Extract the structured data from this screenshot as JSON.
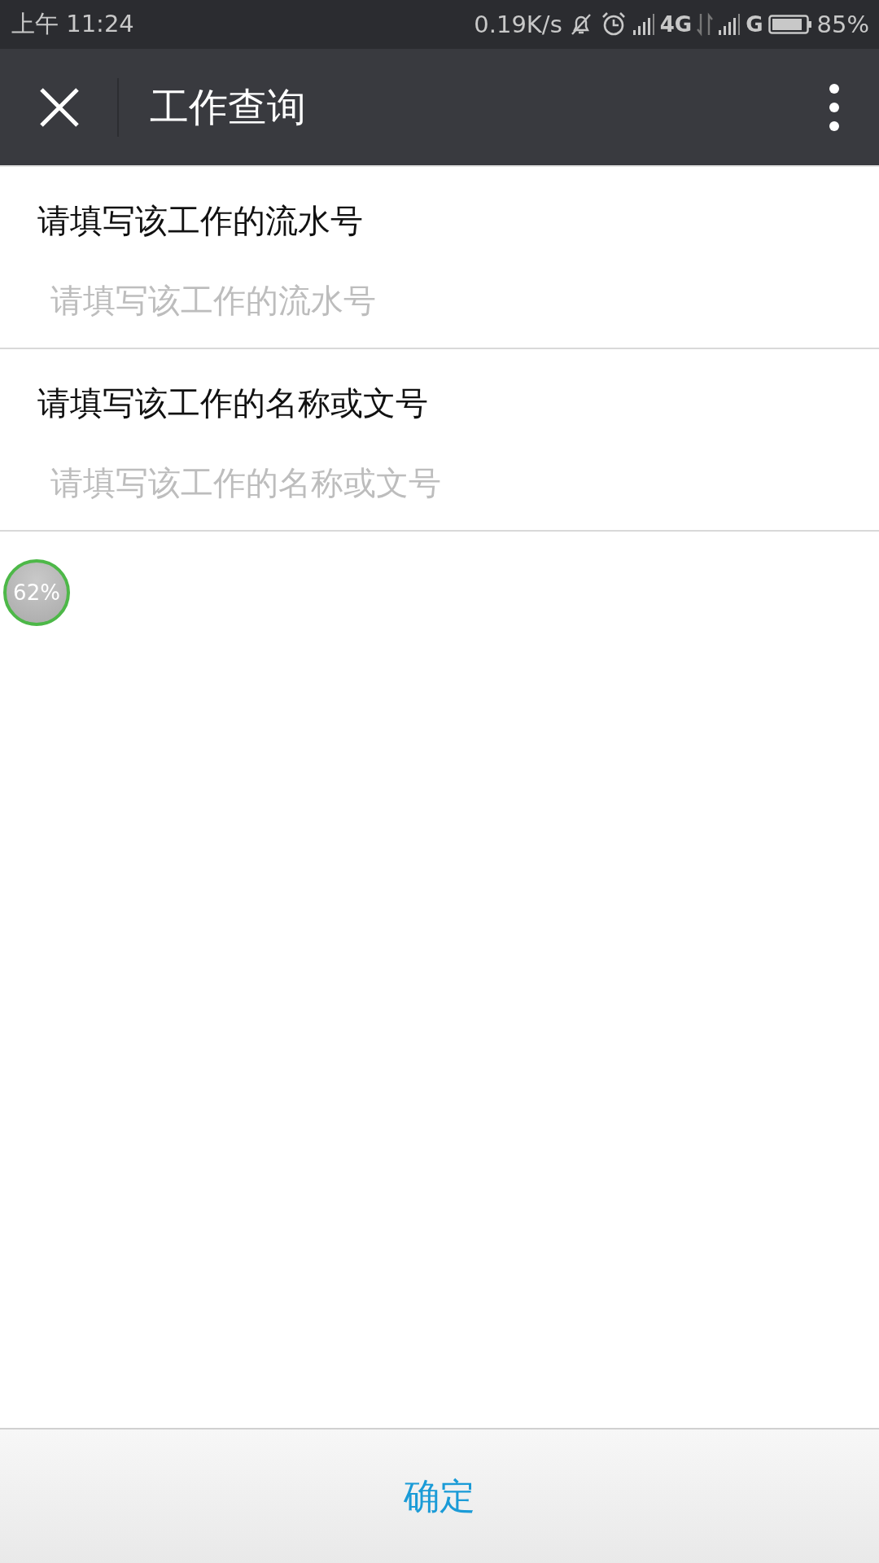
{
  "status_bar": {
    "time": "上午 11:24",
    "speed": "0.19K/s",
    "network_1": "4G",
    "network_2": "G",
    "battery": "85%"
  },
  "header": {
    "title": "工作查询"
  },
  "fields": [
    {
      "label": "请填写该工作的流水号",
      "placeholder": "请填写该工作的流水号"
    },
    {
      "label": "请填写该工作的名称或文号",
      "placeholder": "请填写该工作的名称或文号"
    }
  ],
  "badge": {
    "text": "62%"
  },
  "confirm_button": {
    "label": "确定"
  }
}
